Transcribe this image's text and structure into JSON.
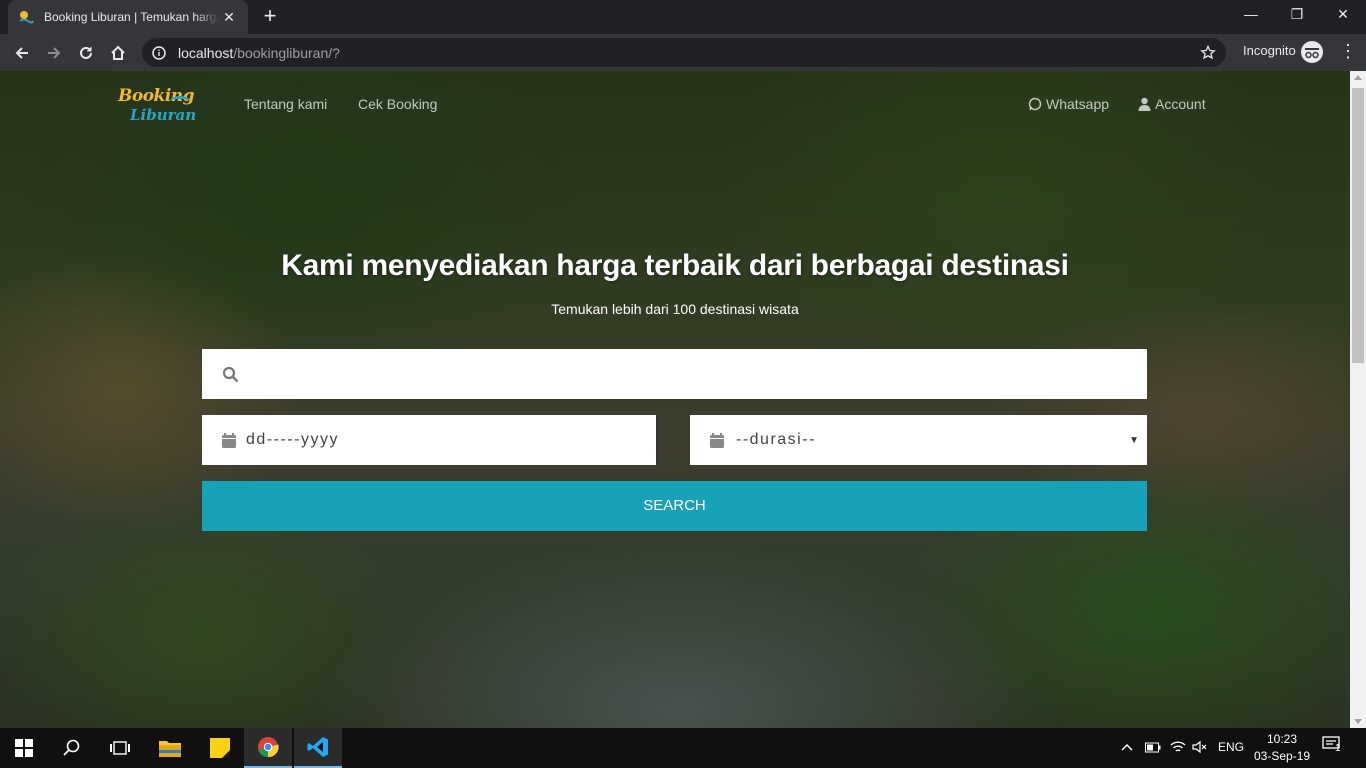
{
  "browser": {
    "tab_title": "Booking Liburan | Temukan harga terbaik",
    "tab_close": "✕",
    "new_tab": "+",
    "url_host": "localhost",
    "url_path": "/bookingliburan/?",
    "incognito_label": "Incognito",
    "window_controls": {
      "minimize": "—",
      "maximize": "❐",
      "close": "✕"
    }
  },
  "site": {
    "logo": {
      "line1": "Booking",
      "line2": "Liburan"
    },
    "nav": {
      "tentang": "Tentang kami",
      "cek_booking": "Cek Booking",
      "whatsapp": "Whatsapp",
      "account": "Account"
    },
    "hero": {
      "title": "Kami menyediakan harga terbaik dari berbagai destinasi",
      "subtitle": "Temukan lebih dari 100 destinasi wisata"
    },
    "search": {
      "placeholder": "",
      "date_placeholder": "dd-----yyyy",
      "duration_placeholder": "--durasi--",
      "button": "SEARCH"
    }
  },
  "taskbar": {
    "language": "ENG",
    "time": "10:23",
    "date": "03-Sep-19",
    "notification_count": "1"
  }
}
